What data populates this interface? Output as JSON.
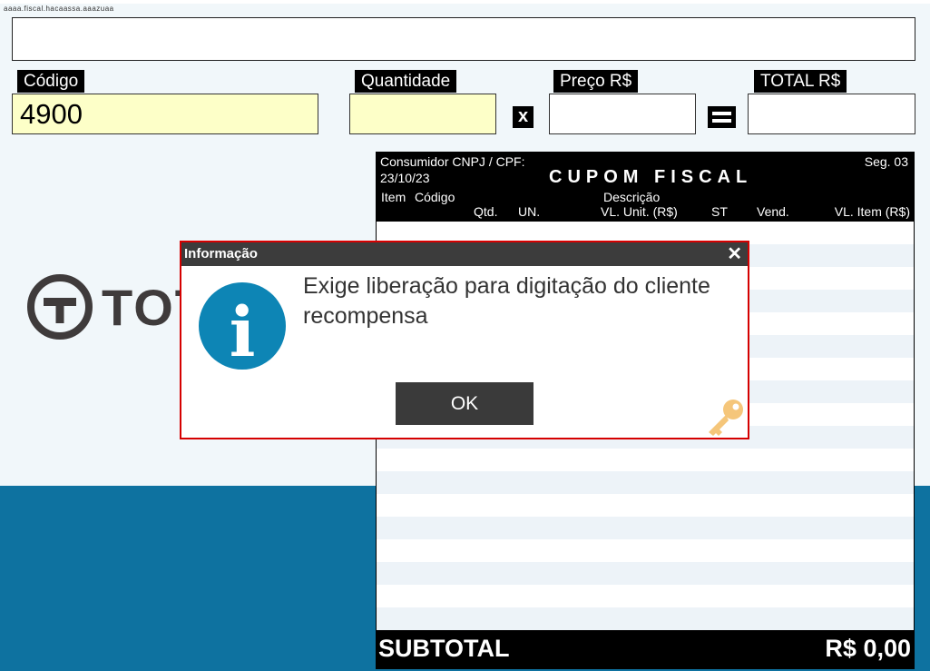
{
  "status_line": "aaaa.fiscal.hacaassa.aaazuaa",
  "fields": {
    "codigo": {
      "label": "Código",
      "value": "4900"
    },
    "quantidade": {
      "label": "Quantidade",
      "value": ""
    },
    "preco": {
      "label": "Preço R$",
      "value": ""
    },
    "total": {
      "label": "TOTAL R$",
      "value": ""
    }
  },
  "operators": {
    "multiply": "x"
  },
  "logo": {
    "text": "TOT"
  },
  "receipt": {
    "consumer_label": "Consumidor CNPJ / CPF:",
    "date": "23/10/23",
    "title": "CUPOM FISCAL",
    "segment": "Seg. 03",
    "columns_top": {
      "item": "Item",
      "codigo": "Código",
      "descricao": "Descrição"
    },
    "columns_bottom": {
      "qtd": "Qtd.",
      "un": "UN.",
      "vl_unit": "VL. Unit. (R$)",
      "st": "ST",
      "vend": "Vend.",
      "vl_item": "VL. Item (R$)"
    },
    "subtotal_label": "SUBTOTAL",
    "subtotal_value": "R$ 0,00"
  },
  "dialog": {
    "title": "Informação",
    "close_glyph": "✕",
    "message": "Exige liberação para digitação do cliente recompensa",
    "ok_label": "OK",
    "icon_glyph": "i"
  },
  "colors": {
    "background": "#f1f7fa",
    "band": "#0e72a0",
    "field_yellow": "#fdffc8",
    "dialog_border": "#d50000",
    "info_icon": "#0d85b5",
    "key_icon": "#f5c67a"
  }
}
